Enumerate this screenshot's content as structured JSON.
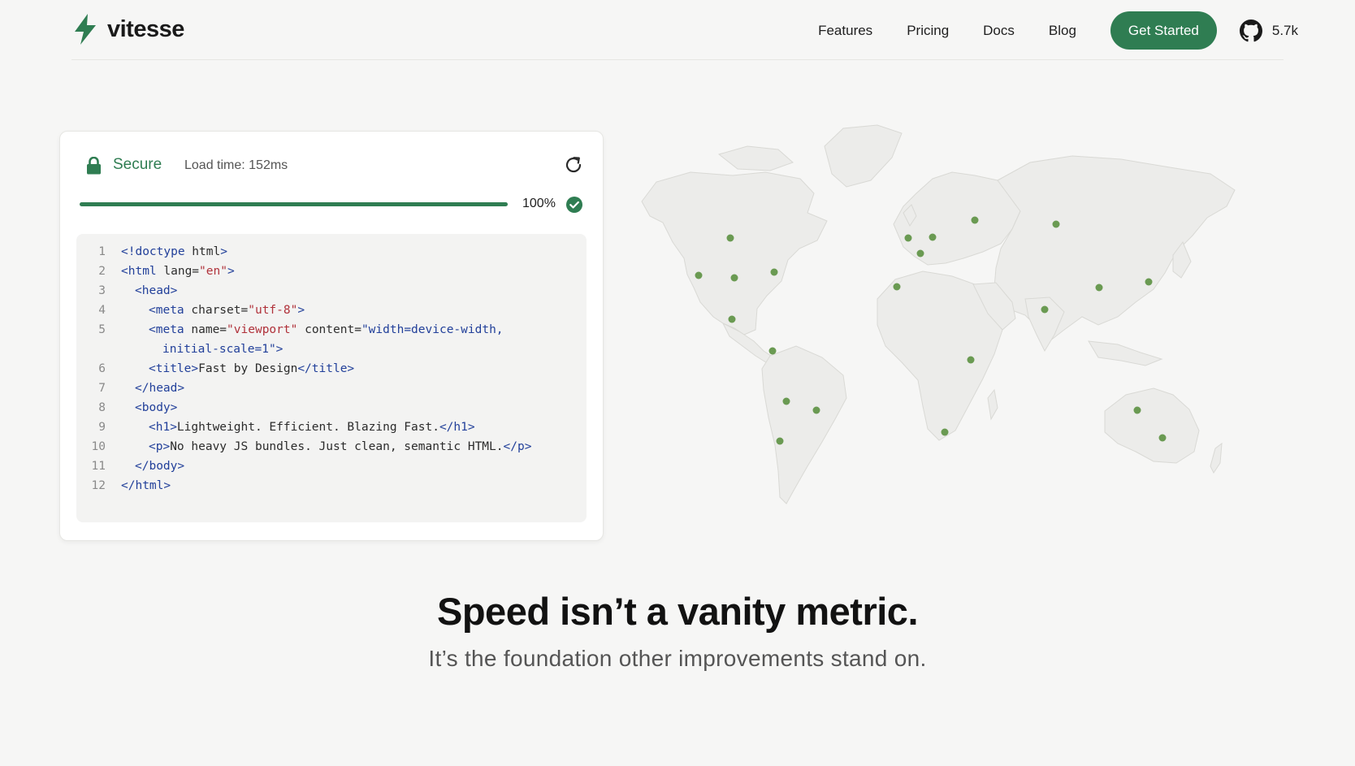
{
  "header": {
    "brand": "vitesse",
    "nav": [
      "Features",
      "Pricing",
      "Docs",
      "Blog"
    ],
    "cta_label": "Get Started",
    "github_stars": "5.7k",
    "icons": {
      "logo": "lightning-bolt-icon",
      "github": "github-icon"
    }
  },
  "browser_card": {
    "secure_label": "Secure",
    "load_time": "Load time: 152ms",
    "progress_percent": 100,
    "progress_label": "100%",
    "icons": {
      "lock": "lock-icon",
      "refresh": "refresh-icon",
      "status": "check-circle-icon"
    },
    "code_lines": [
      {
        "n": "1",
        "indent": 0,
        "parts": [
          [
            "k",
            "<!doctype"
          ],
          [
            "a",
            " html"
          ],
          [
            "k",
            ">"
          ]
        ]
      },
      {
        "n": "2",
        "indent": 0,
        "parts": [
          [
            "k",
            "<html"
          ],
          [
            "a",
            " lang="
          ],
          [
            "s",
            "\"en\""
          ],
          [
            "k",
            ">"
          ]
        ]
      },
      {
        "n": "3",
        "indent": 1,
        "parts": [
          [
            "k",
            "<head>"
          ]
        ]
      },
      {
        "n": "4",
        "indent": 2,
        "parts": [
          [
            "k",
            "<meta"
          ],
          [
            "a",
            " charset="
          ],
          [
            "s",
            "\"utf-8\""
          ],
          [
            "k",
            ">"
          ]
        ]
      },
      {
        "n": "5",
        "indent": 2,
        "parts": [
          [
            "k",
            "<meta"
          ],
          [
            "a",
            " name="
          ],
          [
            "s",
            "\"viewport\""
          ],
          [
            "a",
            " content="
          ],
          [
            "k",
            "\"width=device-width,"
          ]
        ]
      },
      {
        "n": "",
        "indent": 3,
        "parts": [
          [
            "k",
            "initial-scale=1\">"
          ]
        ]
      },
      {
        "n": "6",
        "indent": 2,
        "parts": [
          [
            "k",
            "<title>"
          ],
          [
            "t",
            "Fast by Design"
          ],
          [
            "k",
            "</title>"
          ]
        ]
      },
      {
        "n": "7",
        "indent": 1,
        "parts": [
          [
            "k",
            "</head>"
          ]
        ]
      },
      {
        "n": "8",
        "indent": 1,
        "parts": [
          [
            "k",
            "<body>"
          ]
        ]
      },
      {
        "n": "9",
        "indent": 2,
        "parts": [
          [
            "k",
            "<h1>"
          ],
          [
            "t",
            "Lightweight. Efficient. Blazing Fast."
          ],
          [
            "k",
            "</h1>"
          ]
        ]
      },
      {
        "n": "10",
        "indent": 2,
        "parts": [
          [
            "k",
            "<p>"
          ],
          [
            "t",
            "No heavy JS bundles. Just clean, semantic HTML."
          ],
          [
            "k",
            "</p>"
          ]
        ]
      },
      {
        "n": "11",
        "indent": 1,
        "parts": [
          [
            "k",
            "</body>"
          ]
        ]
      },
      {
        "n": "12",
        "indent": 0,
        "parts": [
          [
            "k",
            "</html>"
          ]
        ]
      }
    ]
  },
  "map": {
    "accent_color": "#6a9a52",
    "land_color": "#ececea",
    "edge_color": "#dcdcd8"
  },
  "hero": {
    "headline": "Speed isn’t a vanity metric.",
    "subhead": "It’s the foundation other improvements stand on."
  },
  "colors": {
    "brand_green": "#2f7d52",
    "background": "#f6f6f5",
    "card": "#ffffff"
  }
}
